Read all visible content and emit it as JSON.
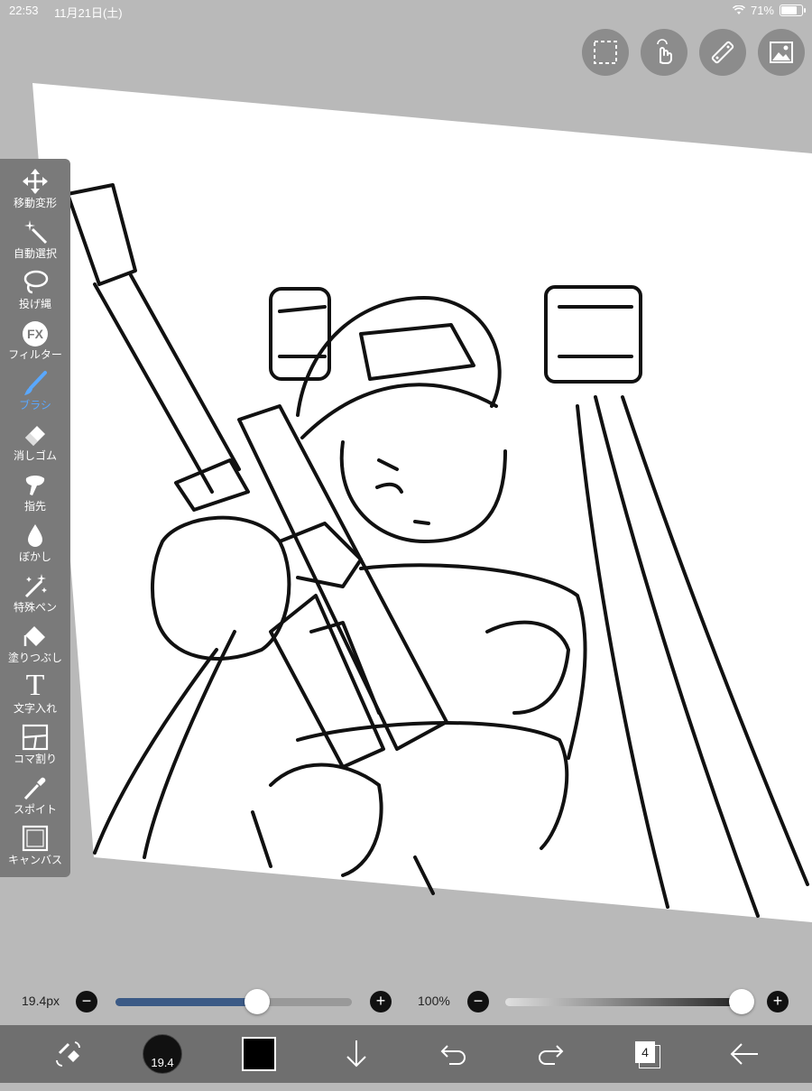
{
  "status_bar": {
    "time": "22:53",
    "date": "11月21日(土)",
    "battery": "71%"
  },
  "top_buttons": [
    "selection-icon",
    "touch-gesture-icon",
    "ruler-icon",
    "gallery-icon"
  ],
  "toolbar": {
    "active": "ブラシ",
    "items": [
      {
        "label": "移動変形",
        "icon": "move-icon"
      },
      {
        "label": "自動選択",
        "icon": "magic-wand-icon"
      },
      {
        "label": "投げ縄",
        "icon": "lasso-icon"
      },
      {
        "label": "フィルター",
        "icon": "fx-icon",
        "icon_text": "FX"
      },
      {
        "label": "ブラシ",
        "icon": "brush-icon"
      },
      {
        "label": "消しゴム",
        "icon": "eraser-icon"
      },
      {
        "label": "指先",
        "icon": "finger-icon"
      },
      {
        "label": "ぼかし",
        "icon": "blur-drop-icon"
      },
      {
        "label": "特殊ペン",
        "icon": "special-pen-icon"
      },
      {
        "label": "塗りつぶし",
        "icon": "fill-icon"
      },
      {
        "label": "文字入れ",
        "icon": "text-icon",
        "icon_text": "T"
      },
      {
        "label": "コマ割り",
        "icon": "frame-divide-icon"
      },
      {
        "label": "スポイト",
        "icon": "eyedropper-icon"
      },
      {
        "label": "キャンバス",
        "icon": "canvas-icon"
      }
    ]
  },
  "brush_size": {
    "value_label": "19.4px",
    "minus": "−",
    "plus": "+",
    "level": 0.6
  },
  "opacity": {
    "value_label": "100%",
    "minus": "−",
    "plus": "+",
    "level": 1.0
  },
  "bottom_bar": {
    "brush_size_badge": "19.4",
    "layer_count": "4",
    "color": "#000000"
  },
  "colors": {
    "accent": "#5aa8ff",
    "slider_fill": "#3b5a86"
  }
}
